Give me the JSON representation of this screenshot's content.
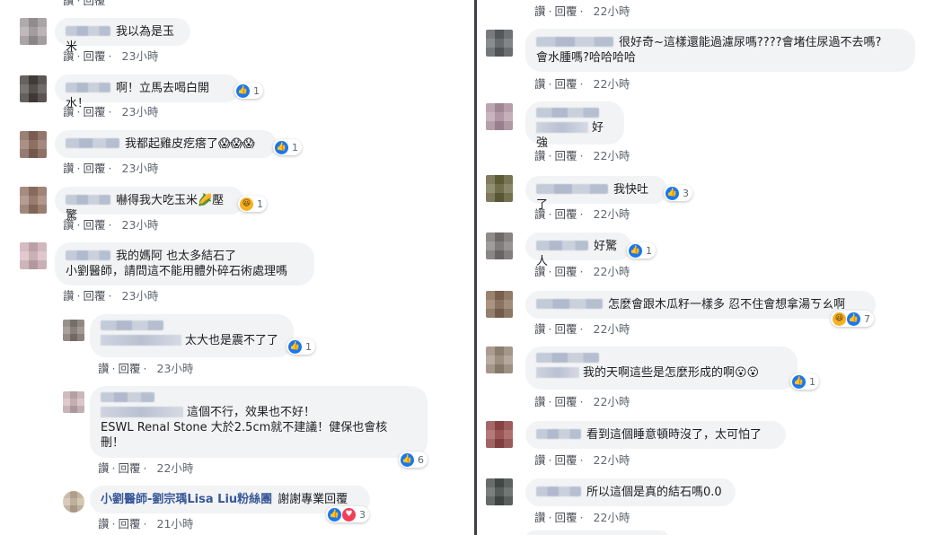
{
  "ui": {
    "like": "讚",
    "reply": "回覆",
    "sep": "·"
  },
  "left": {
    "comments": [
      {
        "text": "我以為是玉米",
        "time": "23小時"
      },
      {
        "text": "啊！立馬去喝白開水！",
        "time": "23小時",
        "reaction_count": "1"
      },
      {
        "text": "我都起雞皮疙瘩了😱😱😱",
        "time": "23小時",
        "reaction_count": "1"
      },
      {
        "text": "嚇得我大吃玉米🌽壓驚",
        "time": "23小時",
        "reaction_count": "1"
      },
      {
        "text_line1": "我的媽阿 也太多結石了",
        "text_line2": "小劉醫師，請問這不能用體外碎石術處理嗎",
        "time": "23小時"
      }
    ],
    "replies": [
      {
        "text": "太大也是震不了了",
        "time": "23小時",
        "reaction_count": "1"
      },
      {
        "text_line1": "這個不行，效果也不好！",
        "text_line2": "ESWL Renal Stone 大於2.5cm就不建議！健保也會核",
        "text_line3": "刪！",
        "time": "22小時",
        "reaction_count": "6"
      },
      {
        "author": "小劉醫師-劉宗瑀Lisa Liu粉絲團",
        "text": "謝謝專業回覆",
        "time": "21小時",
        "reaction_count": "3"
      }
    ]
  },
  "right": {
    "top_time": "22小時",
    "comments": [
      {
        "text_line1": "很好奇~這樣還能過濾尿嗎????會堵住尿過不去嗎?",
        "text_line2": "會水腫嗎?哈哈哈哈",
        "time": "22小時"
      },
      {
        "text": "好強",
        "time": "22小時"
      },
      {
        "text": "我快吐了",
        "time": "22小時",
        "reaction_count": "3"
      },
      {
        "text": "好驚人",
        "time": "22小時",
        "reaction_count": "1"
      },
      {
        "text": "怎麼會跟木瓜籽一樣多 忍不住會想拿湯ㄎㄠ啊",
        "time": "22小時",
        "reaction_count": "7"
      },
      {
        "text": "我的天啊這些是怎麼形成的啊😮😮",
        "time": "22小時",
        "reaction_count": "1"
      },
      {
        "text": "看到這個睡意頓時沒了，太可怕了",
        "time": "22小時"
      },
      {
        "text": "所以這個是真的結石嗎0.0",
        "time": "22小時"
      }
    ]
  },
  "colors": {
    "bubble": "#f2f3f5",
    "like": "#1877f2",
    "author": "#385898",
    "divider": "#3d3f44"
  }
}
